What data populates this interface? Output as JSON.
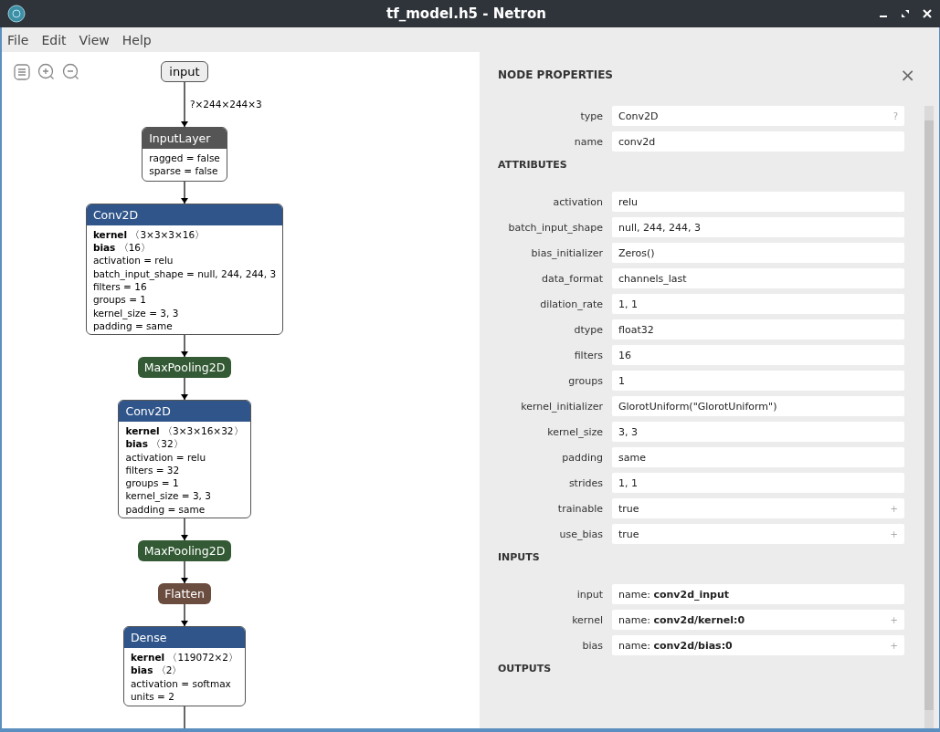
{
  "window": {
    "title": "tf_model.h5 - Netron"
  },
  "menu": [
    "File",
    "Edit",
    "View",
    "Help"
  ],
  "graph": {
    "nodes": [
      {
        "kind": "io",
        "title": "input",
        "edge_label": "?×244×244×3"
      },
      {
        "kind": "box",
        "title": "InputLayer",
        "color": "#555555",
        "lines": [
          "ragged = false",
          "sparse = false"
        ]
      },
      {
        "kind": "box",
        "title": "Conv2D",
        "color": "#2f558a",
        "lines": [
          "**kernel** 〈3×3×3×16〉",
          "**bias** 〈16〉",
          "activation = relu",
          "batch_input_shape = null, 244, 244, 3",
          "filters = 16",
          "groups = 1",
          "kernel_size = 3, 3",
          "padding = same"
        ]
      },
      {
        "kind": "pill",
        "title": "MaxPooling2D",
        "color": "#335a34"
      },
      {
        "kind": "box",
        "title": "Conv2D",
        "color": "#2f558a",
        "lines": [
          "**kernel** 〈3×3×16×32〉",
          "**bias** 〈32〉",
          "activation = relu",
          "filters = 32",
          "groups = 1",
          "kernel_size = 3, 3",
          "padding = same"
        ]
      },
      {
        "kind": "pill",
        "title": "MaxPooling2D",
        "color": "#335a34"
      },
      {
        "kind": "pill",
        "title": "Flatten",
        "color": "#6b4d40"
      },
      {
        "kind": "box",
        "title": "Dense",
        "color": "#2f558a",
        "lines": [
          "**kernel** 〈119072×2〉",
          "**bias** 〈2〉",
          "activation = softmax",
          "units = 2"
        ]
      }
    ]
  },
  "panel": {
    "title": "NODE PROPERTIES",
    "close": "×",
    "sections": [
      {
        "rows": [
          {
            "label": "type",
            "value": "Conv2D",
            "action": "?"
          },
          {
            "label": "name",
            "value": "conv2d"
          }
        ]
      },
      {
        "title": "ATTRIBUTES",
        "rows": [
          {
            "label": "activation",
            "value": "relu"
          },
          {
            "label": "batch_input_shape",
            "value": "null, 244, 244, 3"
          },
          {
            "label": "bias_initializer",
            "value": "Zeros()"
          },
          {
            "label": "data_format",
            "value": "channels_last"
          },
          {
            "label": "dilation_rate",
            "value": "1, 1"
          },
          {
            "label": "dtype",
            "value": "float32"
          },
          {
            "label": "filters",
            "value": "16"
          },
          {
            "label": "groups",
            "value": "1"
          },
          {
            "label": "kernel_initializer",
            "value": "GlorotUniform(\"GlorotUniform\")"
          },
          {
            "label": "kernel_size",
            "value": "3, 3"
          },
          {
            "label": "padding",
            "value": "same"
          },
          {
            "label": "strides",
            "value": "1, 1"
          },
          {
            "label": "trainable",
            "value": "true",
            "action": "+"
          },
          {
            "label": "use_bias",
            "value": "true",
            "action": "+"
          }
        ]
      },
      {
        "title": "INPUTS",
        "rows": [
          {
            "label": "input",
            "value": "name: **conv2d_input**"
          },
          {
            "label": "kernel",
            "value": "name: **conv2d/kernel:0**",
            "action": "+"
          },
          {
            "label": "bias",
            "value": "name: **conv2d/bias:0**",
            "action": "+"
          }
        ]
      },
      {
        "title": "OUTPUTS"
      }
    ]
  }
}
